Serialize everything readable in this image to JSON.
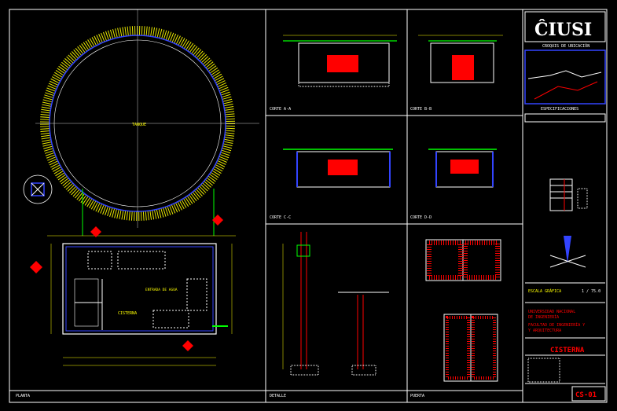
{
  "sheet": {
    "colors": {
      "background": "#000000",
      "frame": "#ffffff",
      "wall": "#ffffff",
      "dimension": "#ffff00",
      "hatch_red": "#ff0000",
      "accent_green": "#00ff00",
      "accent_blue": "#3344ff",
      "accent_cyan": "#00ffff",
      "title_block": "#ffffff"
    }
  },
  "title_block": {
    "logo_text": "ĈIUSI",
    "croquis_label": "CROQUIS DE UBICACIÓN",
    "especificaciones_label": "ESPECIFICACIONES",
    "university_line_1": "UNIVERSIDAD NACIONAL",
    "university_line_2": "DE INGENIERÍA",
    "faculty_line_1": "FACULTAD DE INGENIERÍA Y",
    "faculty_line_2": "Y ARQUITECTURA",
    "scale_label": "ESCALA GRÁFICA",
    "scale_value": "1 / 75.0",
    "drawing_title": "CISTERNA",
    "sheet_code": "CS-01"
  },
  "views": {
    "plan_label": "PLANTA",
    "section_labels": [
      "CORTE A-A",
      "CORTE B-B",
      "CORTE C-C",
      "CORTE D-D",
      "DETALLE",
      "DETALLE",
      "PUERTA"
    ],
    "plan_notes": [
      "TANQUE",
      "CISTERNA",
      "ENTRADA DE AGUA"
    ]
  }
}
